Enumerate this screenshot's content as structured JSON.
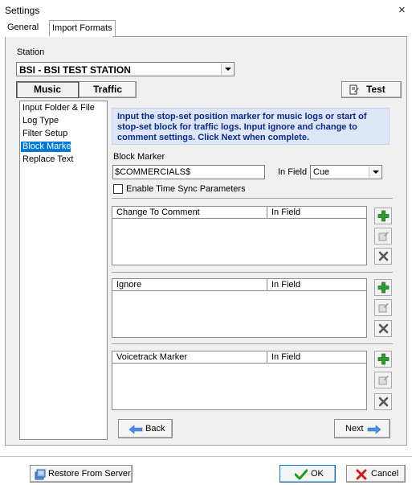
{
  "window": {
    "title": "Settings",
    "close_symbol": "×"
  },
  "tabs": [
    "General",
    "Import Formats"
  ],
  "station": {
    "label": "Station",
    "value": "BSI - BSI TEST STATION"
  },
  "segments": {
    "music": "Music",
    "traffic": "Traffic",
    "test": "Test"
  },
  "nav": {
    "items": [
      "Input Folder & File",
      "Log Type",
      "Filter Setup",
      "Block Marker",
      "Replace Text"
    ],
    "selected": "Block Marker"
  },
  "info_text": "Input the stop-set position marker for music logs or start of stop-set block for traffic logs.  Input ignore and change to comment settings.  Click Next when complete.",
  "block_marker": {
    "label": "Block Marker",
    "value": "$COMMERCIALS$",
    "in_field_label": "In Field",
    "in_field_value": "Cue"
  },
  "time_sync": {
    "label": "Enable Time Sync Parameters",
    "checked": false
  },
  "grids": [
    {
      "col1": "Change To Comment",
      "col2": "In Field"
    },
    {
      "col1": "Ignore",
      "col2": "In Field"
    },
    {
      "col1": "Voicetrack Marker",
      "col2": "In Field"
    }
  ],
  "nav_buttons": {
    "back": "Back",
    "next": "Next"
  },
  "footer": {
    "restore": "Restore From Server",
    "ok": "OK",
    "cancel": "Cancel"
  },
  "colors": {
    "accent": "#0078d7",
    "info_bg": "#dde6f7",
    "info_text": "#0a2a8c",
    "add": "#2e9b2e",
    "remove": "#555555"
  },
  "icons": [
    "close-icon",
    "dropdown-arrow-icon",
    "test-icon",
    "add-icon",
    "edit-icon",
    "delete-icon",
    "back-arrow-icon",
    "next-arrow-icon",
    "server-icon",
    "checkmark-icon",
    "cancel-x-icon"
  ]
}
